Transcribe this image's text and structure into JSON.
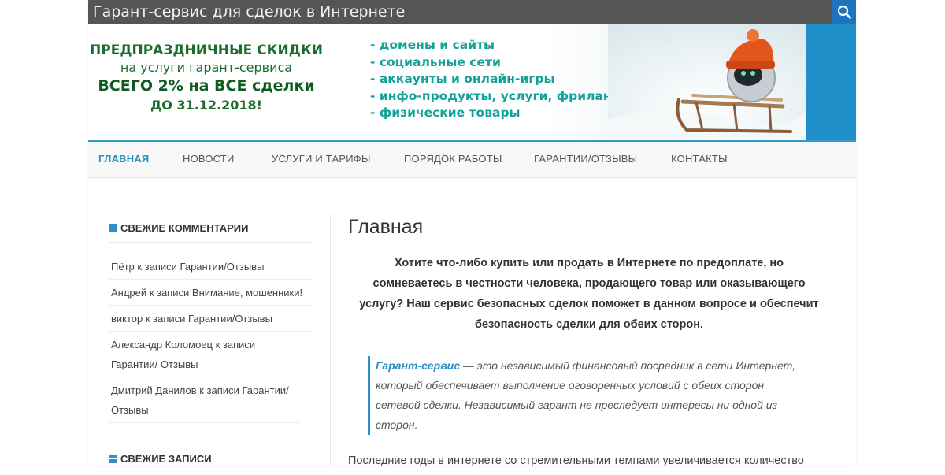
{
  "header": {
    "site_title": "Гарант-сервис для сделок в Интернете",
    "search_icon": "search-icon"
  },
  "banner": {
    "left": {
      "line1": "ПРЕДПРАЗДНИЧНЫЕ СКИДКИ",
      "line2": "на услуги гарант-сервиса",
      "line3": "ВСЕГО 2% на ВСЕ сделки",
      "line4": "ДО 31.12.2018!"
    },
    "list": [
      "- домены и сайты",
      "- социальные сети",
      "- аккаунты и онлайн-игры",
      "- инфо-продукты, услуги, фриланс",
      "- физические товары"
    ],
    "colors": {
      "green": "#1b6d2c",
      "teal": "#12a29a",
      "stripe": "#1e8fc9"
    }
  },
  "nav": {
    "items": [
      {
        "label": "ГЛАВНАЯ",
        "active": true
      },
      {
        "label": "НОВОСТИ",
        "active": false
      },
      {
        "label": "УСЛУГИ И ТАРИФЫ",
        "active": false
      },
      {
        "label": "ПОРЯДОК РАБОТЫ",
        "active": false
      },
      {
        "label": "ГАРАНТИИ/ОТЗЫВЫ",
        "active": false
      },
      {
        "label": "КОНТАКТЫ",
        "active": false
      }
    ],
    "accent": "#2d8fc4"
  },
  "sidebar": {
    "recent_comments_title": "СВЕЖИЕ КОММЕНТАРИИ",
    "comments": [
      "Пётр к записи Гарантии/Отзывы",
      "Андрей к записи Внимание, мошенники!",
      "виктор к записи Гарантии/Отзывы",
      "Александр Коломоец к записи Гарантии/ Отзывы",
      "Дмитрий Данилов к записи Гарантии/ Отзывы"
    ],
    "recent_posts_title": "СВЕЖИЕ ЗАПИСИ"
  },
  "content": {
    "title": "Главная",
    "intro": "Хотите что-либо купить или продать в Интернете по предоплате, но сомневаетесь в честности человека, продающего товар или оказывающего услугу? Наш сервис безопасных сделок поможет в данном вопросе и обеспечит безопасность сделки для обеих сторон.",
    "quote_strong": "Гарант-сервис",
    "quote_rest": " — это независимый финансовый посредник в сети Интернет, который обеспечивает выполнение оговоренных условий с обеих сторон сетевой сделки. Независимый гарант не преследует интересы ни одной из сторон.",
    "paragraph": "Последние годы в интернете со стремительными темпами увеличивается количество"
  }
}
